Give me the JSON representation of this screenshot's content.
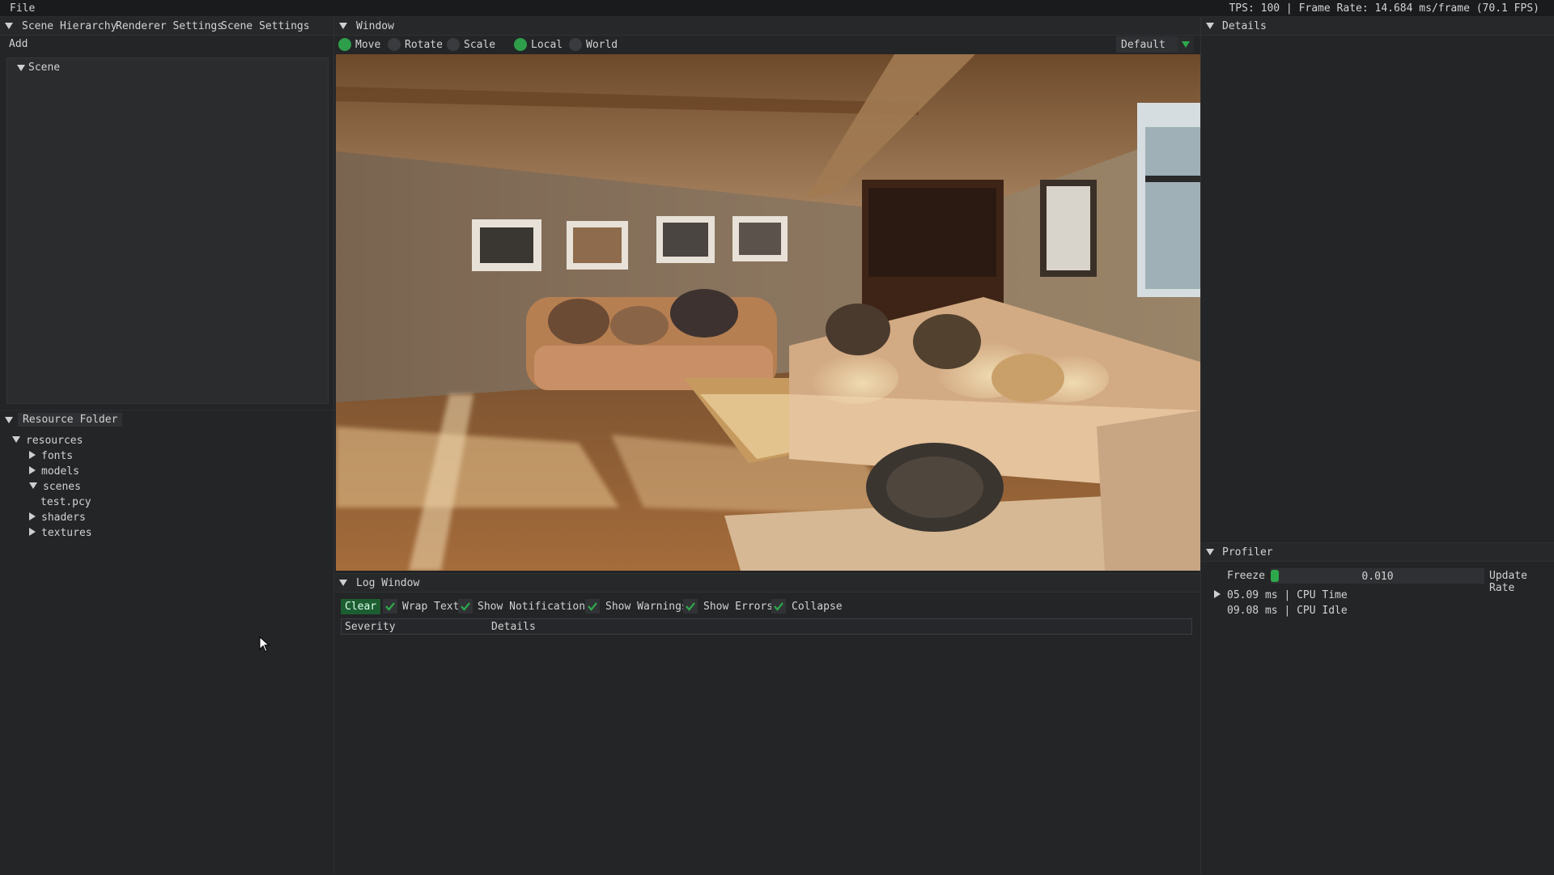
{
  "menubar": {
    "file_label": "File",
    "stats": "TPS: 100 | Frame Rate: 14.684 ms/frame (70.1 FPS)"
  },
  "left_panel": {
    "tabs": [
      "Scene Hierarchy",
      "Renderer Settings",
      "Scene Settings"
    ],
    "add_label": "Add",
    "scene_label": "Scene"
  },
  "resource_panel": {
    "title": "Resource Folder",
    "tree": [
      {
        "label": "resources",
        "state": "expanded",
        "depth": 0
      },
      {
        "label": "fonts",
        "state": "collapsed",
        "depth": 1
      },
      {
        "label": "models",
        "state": "collapsed",
        "depth": 1
      },
      {
        "label": "scenes",
        "state": "expanded",
        "depth": 1
      },
      {
        "label": "test.pcy",
        "state": "leaf",
        "depth": 2
      },
      {
        "label": "shaders",
        "state": "collapsed",
        "depth": 1
      },
      {
        "label": "textures",
        "state": "collapsed",
        "depth": 1
      }
    ]
  },
  "viewport_panel": {
    "title": "Window",
    "tools": [
      {
        "label": "Move",
        "selected": true
      },
      {
        "label": "Rotate",
        "selected": false
      },
      {
        "label": "Scale",
        "selected": false
      },
      {
        "label": "Local",
        "selected": true
      },
      {
        "label": "World",
        "selected": false
      }
    ],
    "preset_value": "Default",
    "scene_image": "rendered living room interior with sofa, coffee table and sunlight through window"
  },
  "log_panel": {
    "title": "Log Window",
    "clear_label": "Clear",
    "options": [
      {
        "label": "Wrap Text",
        "checked": true
      },
      {
        "label": "Show Notifications",
        "checked": true
      },
      {
        "label": "Show Warnings",
        "checked": true
      },
      {
        "label": "Show Errors",
        "checked": true
      },
      {
        "label": "Collapse",
        "checked": true
      }
    ],
    "columns": [
      "Severity",
      "Details"
    ]
  },
  "details_panel": {
    "title": "Details"
  },
  "profiler_panel": {
    "title": "Profiler",
    "freeze_label": "Freeze",
    "freeze_value": "0.010",
    "update_rate_label": "Update Rate",
    "cpu_time": "05.09 ms | CPU Time",
    "cpu_idle": "09.08 ms | CPU Idle"
  },
  "colors": {
    "accent_green": "#2e9e4a",
    "panel_bg": "#242527",
    "text": "#d2d2d2"
  }
}
